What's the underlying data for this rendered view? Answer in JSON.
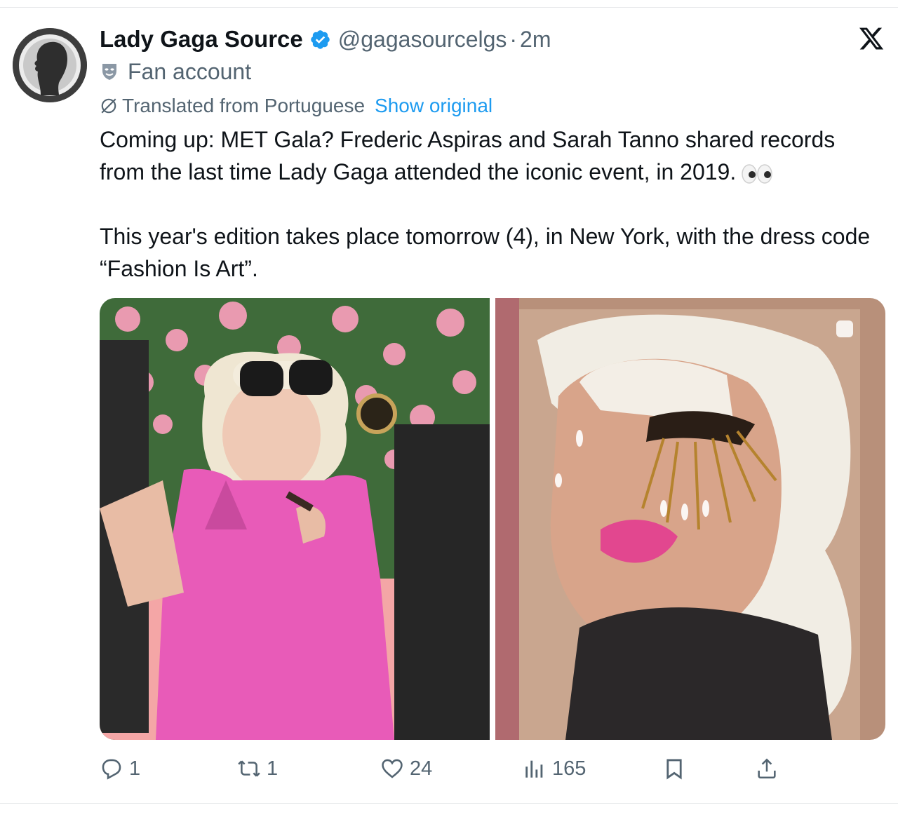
{
  "author": {
    "name": "Lady Gaga Source",
    "handle": "@gagasourcelgs",
    "separator": "·",
    "time": "2m",
    "label": "Fan account",
    "verified": true
  },
  "translation": {
    "notice": "Translated from Portuguese",
    "show_original": "Show original"
  },
  "tweet": {
    "paragraph1": "Coming up: MET Gala? Frederic Aspiras and Sarah Tanno shared records from the last time Lady Gaga attended the iconic event, in 2019.",
    "paragraph2": "This year's edition takes place tomorrow (4), in New York, with the dress code “Fashion Is Art”."
  },
  "media": [
    {
      "icon": "photo-pink-dress-sunglasses"
    },
    {
      "icon": "photo-makeup-closeup"
    }
  ],
  "actions": {
    "replies": "1",
    "reposts": "1",
    "likes": "24",
    "views": "165"
  },
  "icons": {
    "platform": "x-logo-icon",
    "verified": "verified-badge-icon",
    "label": "fan-account-mask-icon"
  },
  "colors": {
    "accent": "#1d9bf0",
    "secondary_text": "#536471",
    "primary_text": "#0f1419"
  }
}
